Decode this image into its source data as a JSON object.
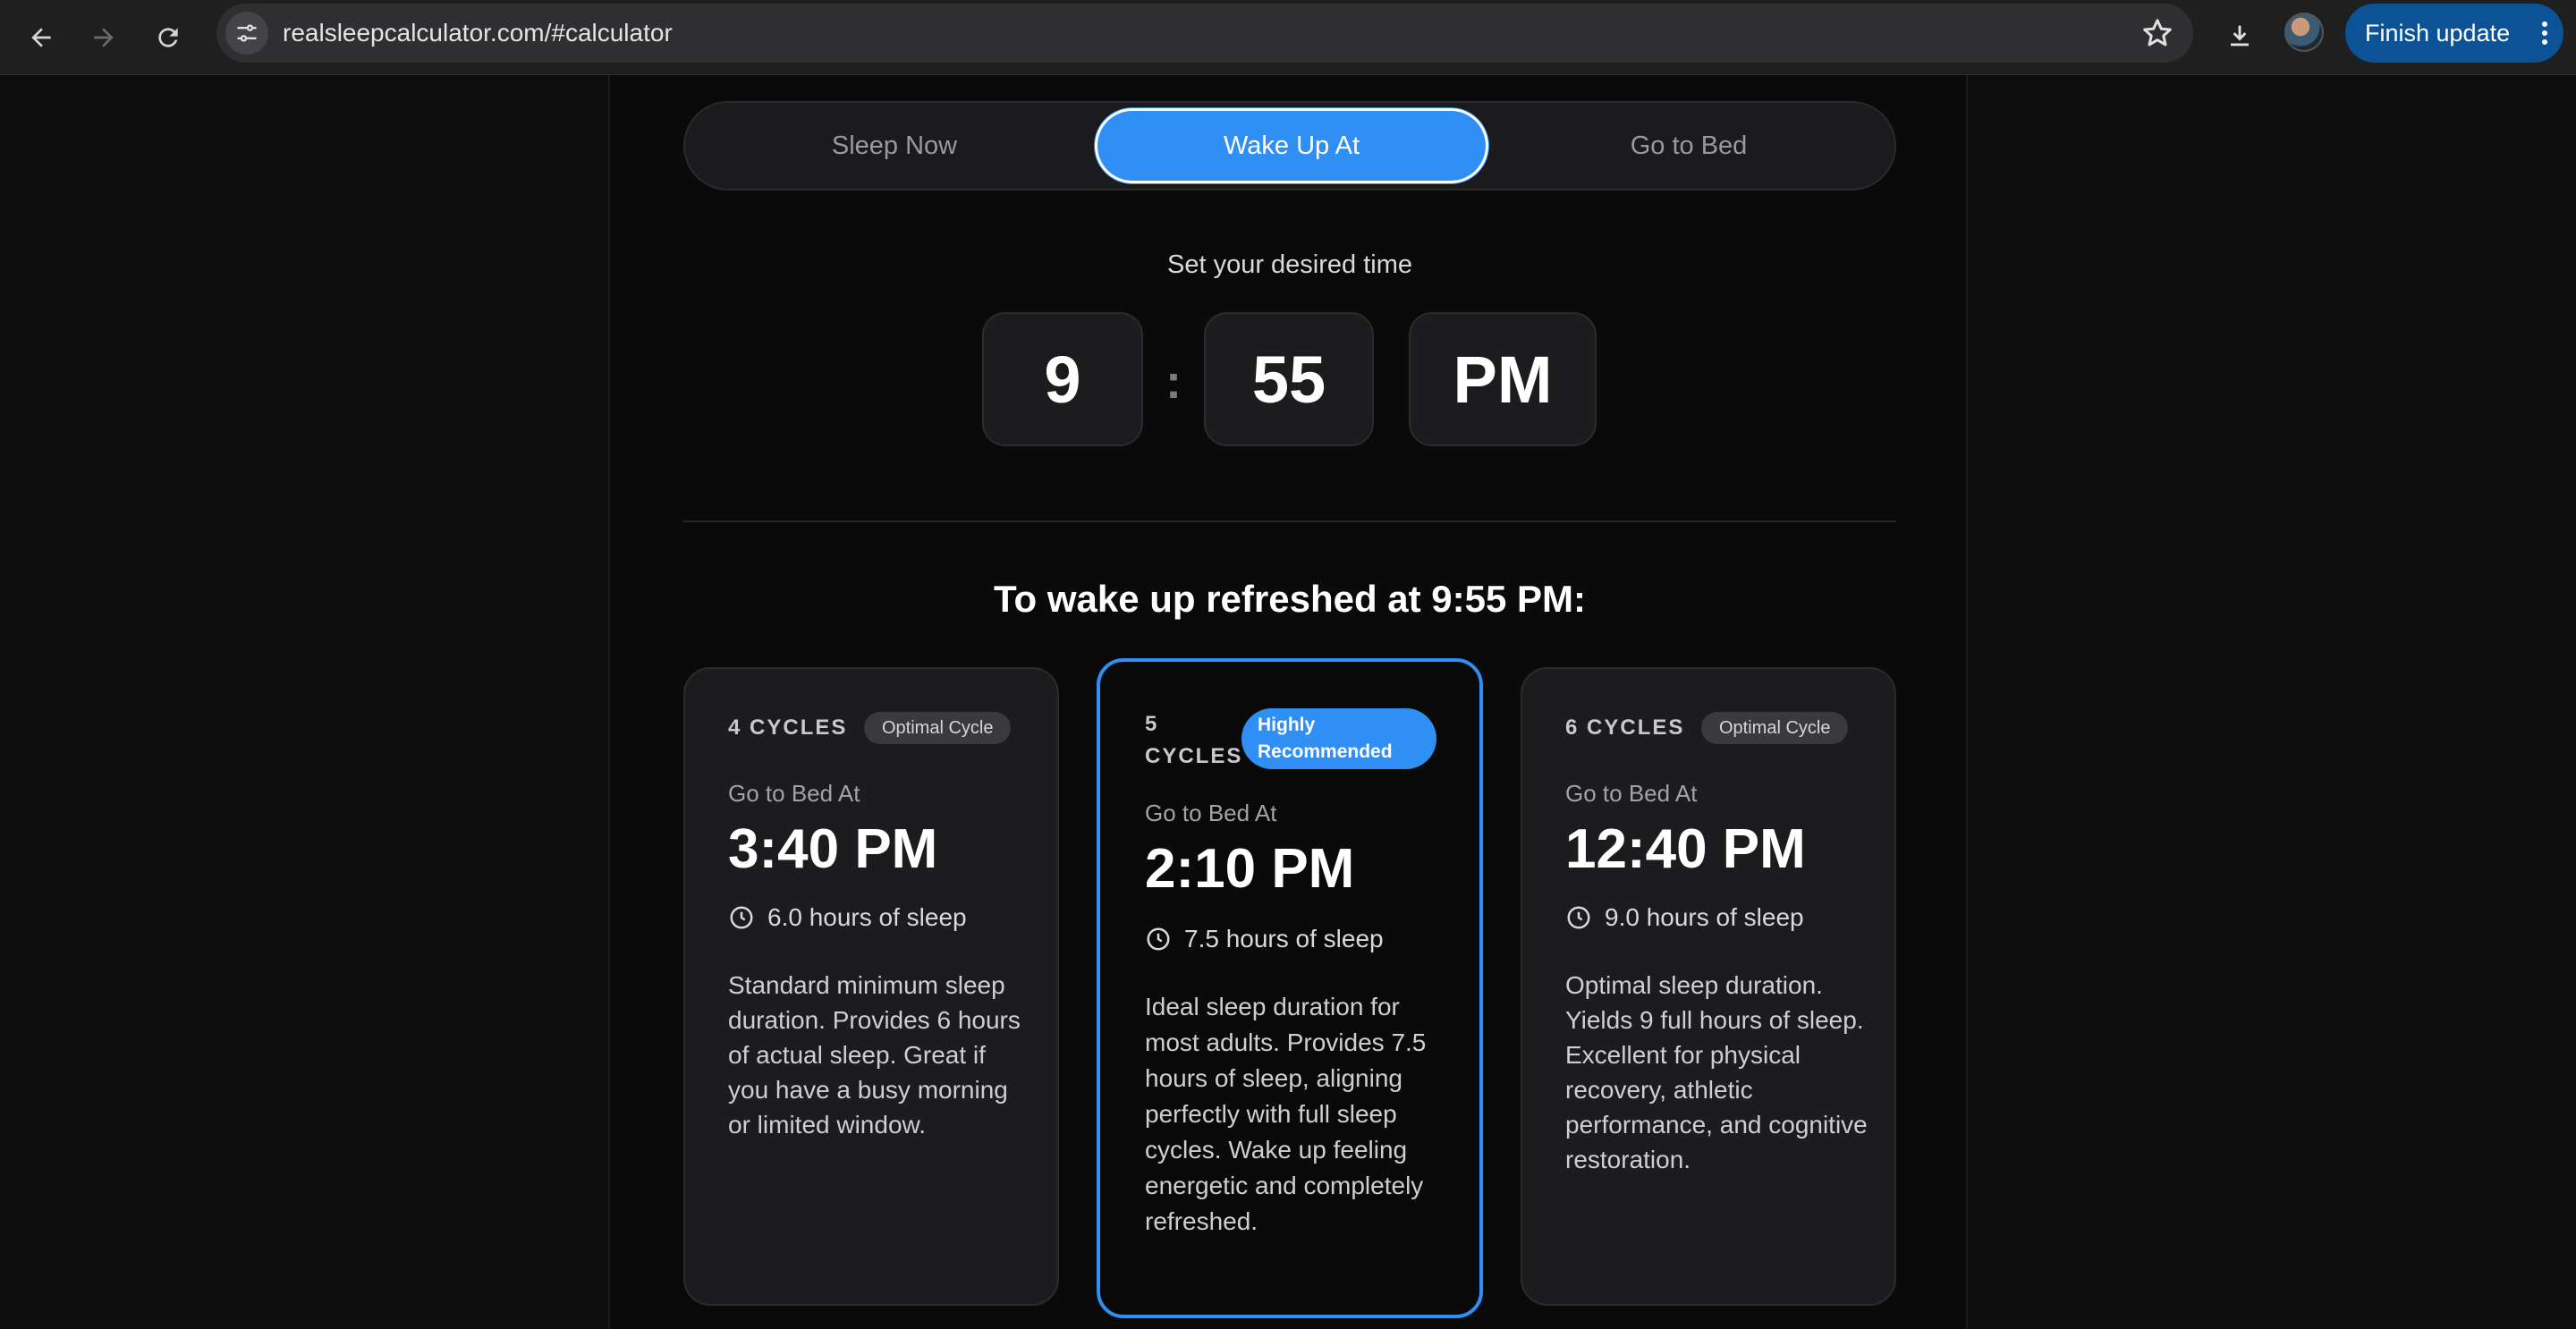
{
  "browser": {
    "url": "realsleepcalculator.com/#calculator",
    "update_button": "Finish update",
    "icons": [
      "back-arrow-icon",
      "forward-arrow-icon",
      "reload-icon",
      "site-settings-icon",
      "bookmark-star-icon",
      "download-icon",
      "profile-avatar",
      "more-vert-icon"
    ]
  },
  "tabs": {
    "items": [
      {
        "label": "Sleep Now",
        "active": false
      },
      {
        "label": "Wake Up At",
        "active": true
      },
      {
        "label": "Go to Bed",
        "active": false
      }
    ]
  },
  "time_picker": {
    "label": "Set your desired time",
    "hour": "9",
    "separator": ":",
    "minute": "55",
    "period": "PM"
  },
  "results": {
    "heading": "To wake up refreshed at 9:55 PM:",
    "cards": [
      {
        "cycles": "4 CYCLES",
        "badge": "Optimal Cycle",
        "label": "Go to Bed At",
        "time": "3:40 PM",
        "hours": "6.0 hours of sleep",
        "description": "Standard minimum sleep duration. Provides 6 hours of actual sleep. Great if you have a busy morning or limited window."
      },
      {
        "cycles": "5 CYCLES",
        "badge": "Highly Recommended",
        "label": "Go to Bed At",
        "time": "2:10 PM",
        "hours": "7.5 hours of sleep",
        "description": "Ideal sleep duration for most adults. Provides 7.5 hours of sleep, aligning perfectly with full sleep cycles. Wake up feeling energetic and completely refreshed."
      },
      {
        "cycles": "6 CYCLES",
        "badge": "Optimal Cycle",
        "label": "Go to Bed At",
        "time": "12:40 PM",
        "hours": "9.0 hours of sleep",
        "description": "Optimal sleep duration. Yields 9 full hours of sleep. Excellent for physical recovery, athletic performance, and cognitive restoration."
      }
    ]
  },
  "colors": {
    "accent": "#2f8ff5",
    "background": "#0a0a0a",
    "card": "#1c1c1e",
    "update_button": "#0b5394"
  }
}
